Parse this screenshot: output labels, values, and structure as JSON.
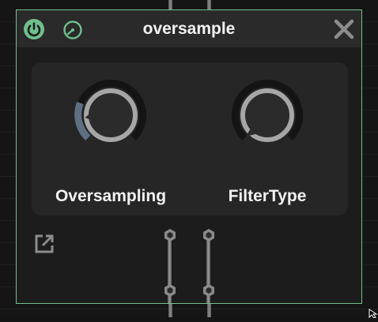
{
  "module": {
    "title": "oversample",
    "accent_color": "#6fbf8c"
  },
  "titlebar": {
    "power_icon": "power-icon",
    "meter_icon": "gauge-icon",
    "close_icon": "close-icon"
  },
  "knobs": [
    {
      "label": "Oversampling",
      "value": 0.1
    },
    {
      "label": "FilterType",
      "value": 0.0
    }
  ],
  "footer": {
    "popout_icon": "external-window-icon"
  }
}
